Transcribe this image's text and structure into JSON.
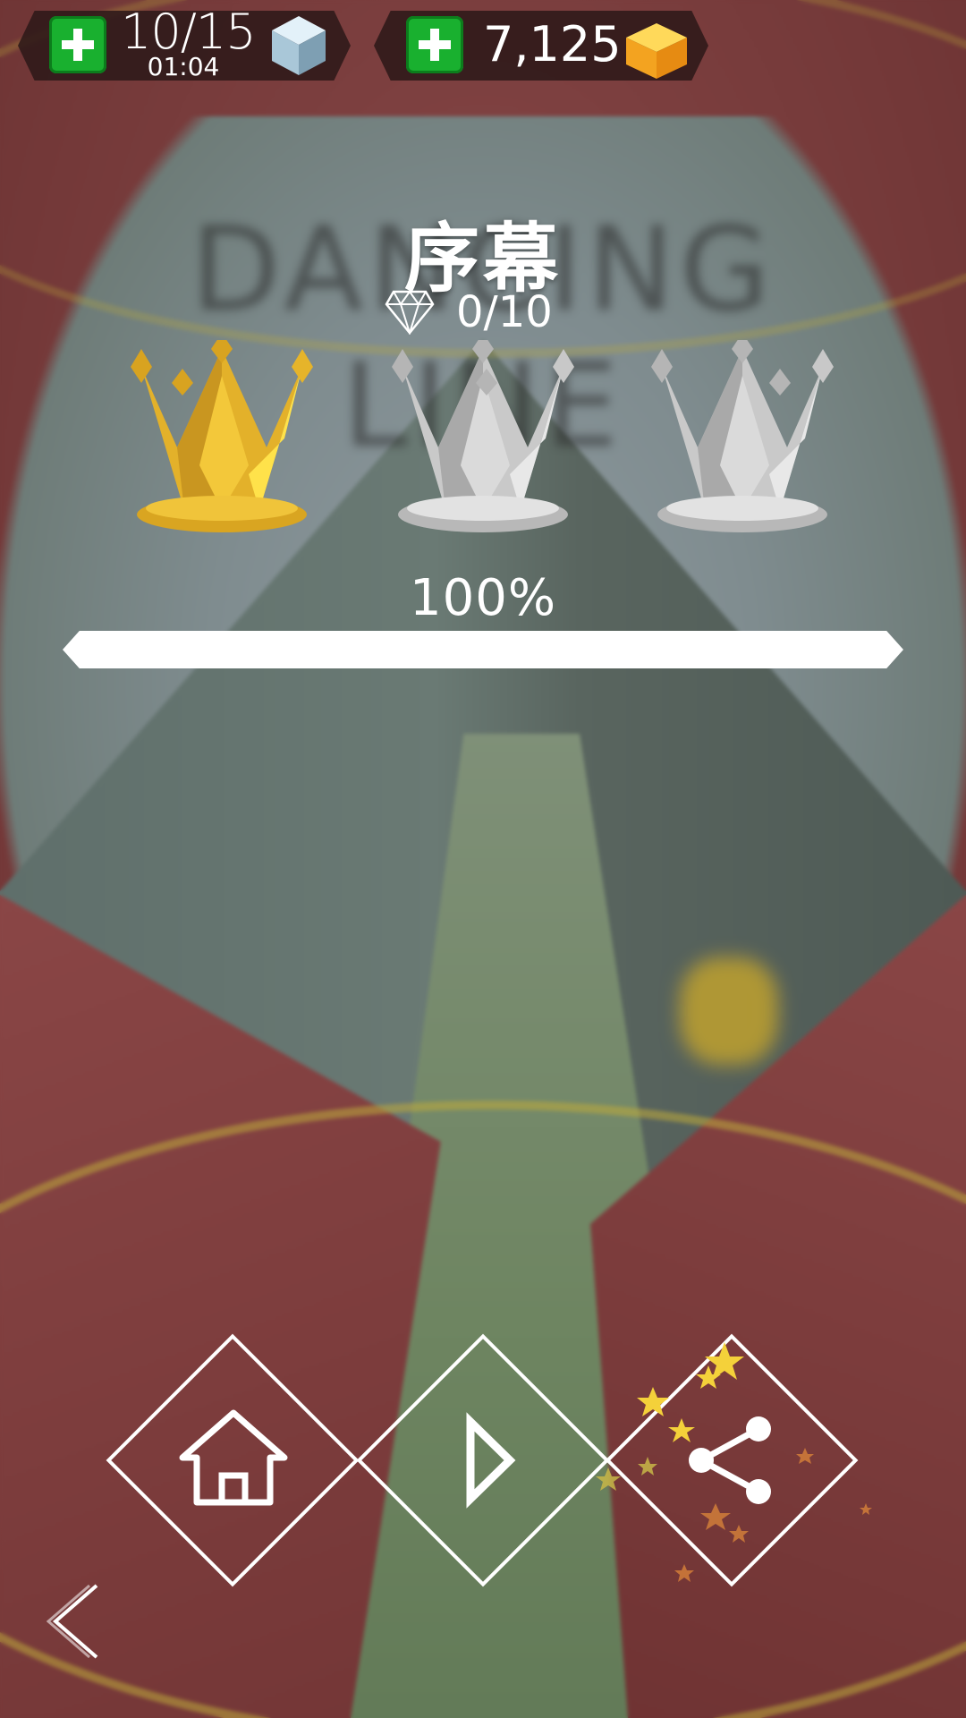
{
  "hud": {
    "lives": "10/15",
    "lives_timer": "01:04",
    "coins": "7,125"
  },
  "background": {
    "watermark_text": "DANCING LINE"
  },
  "level": {
    "title": "序幕",
    "diamonds": "0/10",
    "crowns": [
      {
        "name": "crown-1",
        "earned": true
      },
      {
        "name": "crown-2",
        "earned": false
      },
      {
        "name": "crown-3",
        "earned": false
      }
    ],
    "progress_text": "100%",
    "progress_fraction": 1.0
  },
  "icons": {
    "lives_icon": "cube-icon",
    "coins_icon": "gem-icon",
    "diamond_icon": "diamond-icon",
    "home": "home-icon",
    "play": "play-icon",
    "share": "share-icon",
    "back": "chevron-left-icon"
  },
  "colors": {
    "plus_green": "#19b02f",
    "crown_gold": "#e9b52a",
    "crown_silver": "#cfcfcf",
    "bar": "#ffffff"
  }
}
